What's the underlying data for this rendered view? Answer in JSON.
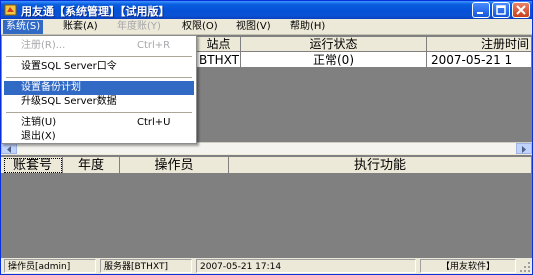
{
  "window": {
    "title": "用友通【系统管理】【试用版】",
    "controls": {
      "minimize": "minimize",
      "maximize": "maximize",
      "close": "close"
    }
  },
  "menubar": [
    {
      "label": "系统(S)",
      "state": "active"
    },
    {
      "label": "账套(A)",
      "state": "normal"
    },
    {
      "label": "年度账(Y)",
      "state": "disabled"
    },
    {
      "label": "权限(O)",
      "state": "normal"
    },
    {
      "label": "视图(V)",
      "state": "normal"
    },
    {
      "label": "帮助(H)",
      "state": "normal"
    }
  ],
  "system_menu": {
    "items": [
      {
        "label": "注册(R)...",
        "shortcut": "Ctrl+R",
        "state": "disabled"
      },
      {
        "label": "设置SQL Server口令",
        "shortcut": "",
        "state": "normal"
      },
      {
        "label": "设置备份计划",
        "shortcut": "",
        "state": "highlight"
      },
      {
        "label": "升级SQL Server数据",
        "shortcut": "",
        "state": "normal"
      },
      {
        "label": "注销(U)",
        "shortcut": "Ctrl+U",
        "state": "normal"
      },
      {
        "label": "退出(X)",
        "shortcut": "",
        "state": "normal"
      }
    ]
  },
  "top_grid": {
    "headers": [
      "站点",
      "运行状态",
      "注册时间"
    ],
    "rows": [
      {
        "site": "BTHXT",
        "status": "正常(0)",
        "time": "2007-05-21 1"
      }
    ]
  },
  "bottom_grid": {
    "headers": [
      "账套号",
      "年度",
      "操作员",
      "执行功能"
    ]
  },
  "statusbar": {
    "operator": "操作员[admin]",
    "server": "服务器[BTHXT]",
    "datetime": "2007-05-21 17:14",
    "brand": "【用友软件】"
  },
  "colors": {
    "titlebar": "#0551d7",
    "menu_highlight": "#316ac5",
    "window_face": "#ece9d8",
    "grid_background": "#808080"
  }
}
